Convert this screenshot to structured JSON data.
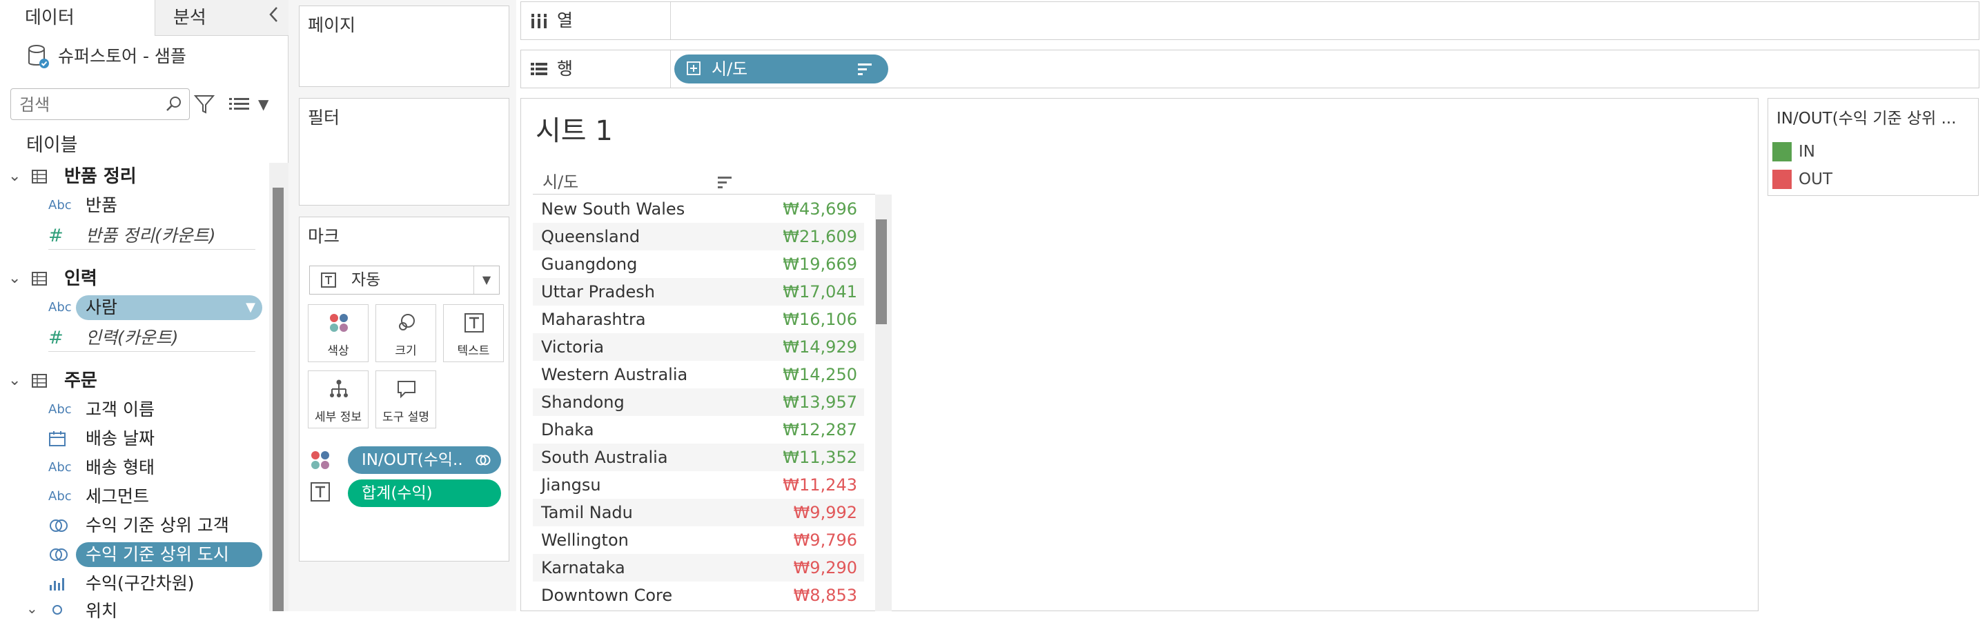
{
  "left_pane": {
    "tabs": [
      "데이터",
      "분석"
    ],
    "datasource": "슈퍼스토어 - 샘플",
    "search_placeholder": "검색",
    "tables_header": "테이블",
    "tables": [
      {
        "name": "반품 정리",
        "fields": [
          {
            "type": "Abc",
            "name": "반품"
          },
          {
            "type": "#",
            "name": "반품 정리(카운트)"
          }
        ]
      },
      {
        "name": "인력",
        "fields": [
          {
            "type": "Abc",
            "name": "사람"
          },
          {
            "type": "#",
            "name": "인력(카운트)"
          }
        ]
      },
      {
        "name": "주문",
        "fields": [
          {
            "type": "Abc",
            "name": "고객 이름"
          },
          {
            "type": "date",
            "name": "배송 날짜"
          },
          {
            "type": "Abc",
            "name": "배송 형태"
          },
          {
            "type": "Abc",
            "name": "세그먼트"
          },
          {
            "type": "set",
            "name": "수익 기준 상위 고객"
          },
          {
            "type": "set",
            "name": "수익 기준 상위 도시"
          },
          {
            "type": "bin",
            "name": "수익(구간차원)"
          },
          {
            "type": "geo",
            "name": "위치"
          }
        ]
      }
    ]
  },
  "cards": {
    "pages": "페이지",
    "filters": "필터",
    "marks": "마크",
    "marks_type": "자동",
    "mark_buttons": [
      "색상",
      "크기",
      "텍스트",
      "세부 정보",
      "도구 설명"
    ],
    "mark_pills": [
      "IN/OUT(수익..",
      "합계(수익)"
    ]
  },
  "shelves": {
    "columns": "열",
    "rows": "행",
    "rows_pill": "시/도"
  },
  "sheet": {
    "title": "시트 1",
    "column_header": "시/도",
    "rows": [
      {
        "name": "New South Wales",
        "value": "₩43,696",
        "status": "IN"
      },
      {
        "name": "Queensland",
        "value": "₩21,609",
        "status": "IN"
      },
      {
        "name": "Guangdong",
        "value": "₩19,669",
        "status": "IN"
      },
      {
        "name": "Uttar Pradesh",
        "value": "₩17,041",
        "status": "IN"
      },
      {
        "name": "Maharashtra",
        "value": "₩16,106",
        "status": "IN"
      },
      {
        "name": "Victoria",
        "value": "₩14,929",
        "status": "IN"
      },
      {
        "name": "Western Australia",
        "value": "₩14,250",
        "status": "IN"
      },
      {
        "name": "Shandong",
        "value": "₩13,957",
        "status": "IN"
      },
      {
        "name": "Dhaka",
        "value": "₩12,287",
        "status": "IN"
      },
      {
        "name": "South Australia",
        "value": "₩11,352",
        "status": "IN"
      },
      {
        "name": "Jiangsu",
        "value": "₩11,243",
        "status": "OUT"
      },
      {
        "name": "Tamil Nadu",
        "value": "₩9,992",
        "status": "OUT"
      },
      {
        "name": "Wellington",
        "value": "₩9,796",
        "status": "OUT"
      },
      {
        "name": "Karnataka",
        "value": "₩9,290",
        "status": "OUT"
      },
      {
        "name": "Downtown Core",
        "value": "₩8,853",
        "status": "OUT"
      }
    ]
  },
  "legend": {
    "title": "IN/OUT(수익 기준 상위 ...",
    "items": [
      {
        "label": "IN",
        "color": "#59a14f"
      },
      {
        "label": "OUT",
        "color": "#e15759"
      }
    ]
  },
  "colors": {
    "in_text": "#59a14f",
    "out_text": "#e15759",
    "pill_blue": "#4f93b0",
    "pill_green": "#00b180"
  }
}
